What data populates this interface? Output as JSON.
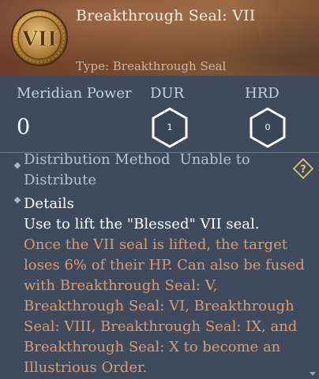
{
  "item": {
    "name": "Breakthrough Seal: VII",
    "type": "Type: Breakthrough Seal",
    "icon": "breakthrough-seal-coin-icon",
    "emblem_text": "VII"
  },
  "stats": {
    "meridian_power_label": "Meridian Power",
    "meridian_power_value": "0",
    "dur_label": "DUR",
    "dur_value": "1",
    "hrd_label": "HRD",
    "hrd_value": "0"
  },
  "distribution": {
    "label": "Distribution Method",
    "value": "Unable to Distribute"
  },
  "details": {
    "title": "Details",
    "line_white": "Use to lift the \"Blessed\" VII seal.",
    "text_orange": "Once the VII seal is lifted, the target loses 6% of their HP. Can also be fused with Breakthrough Seal: V, Breakthrough Seal: VI, Breakthrough Seal: VIII, Breakthrough Seal: IX, and Breakthrough Seal: X to become an Illustrious Order."
  },
  "colors": {
    "panel_bg": "#3f4a5c",
    "header_bg": "#7d4a2e",
    "orange_text": "#e09a6a",
    "help_icon": "#e3c46a"
  }
}
